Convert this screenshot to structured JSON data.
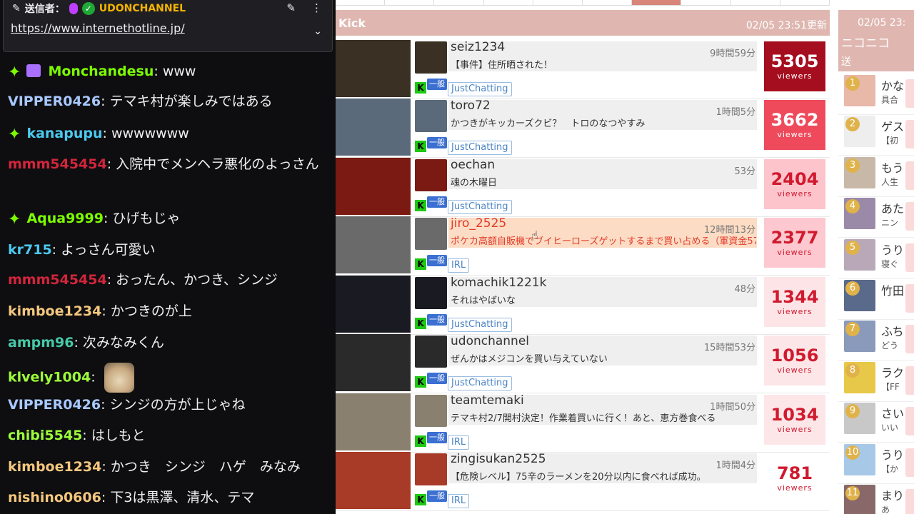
{
  "chat": {
    "pinned": {
      "pin_icon": "pin-icon",
      "sender_label": "送信者：",
      "channel": "UDONCHANNEL",
      "url": "https://www.internethotline.jp/",
      "colors": {
        "mic": "#bf3fff",
        "verified": "#1fa836",
        "channel": "#f4b400"
      }
    },
    "messages": [
      {
        "badges": [
          "sparkle-badge",
          "gift-badge"
        ],
        "user": "Monchandesu",
        "color": "#7CFC00",
        "text": "www"
      },
      {
        "badges": [],
        "user": "VIPPER0426",
        "color": "#a8c8ff",
        "text": "テマキ村が楽しみではある"
      },
      {
        "badges": [
          "sparkle-badge"
        ],
        "user": "kanapupu",
        "color": "#4cc9f0",
        "text": "wwwwwww"
      },
      {
        "badges": [],
        "user": "mmm545454",
        "color": "#d3253c",
        "text": "入院中でメンヘラ悪化のよっさん"
      },
      {
        "badges": [
          "sparkle-badge"
        ],
        "user": "Aqua9999",
        "color": "#7CFC00",
        "text": "ひげもじゃ"
      },
      {
        "badges": [],
        "user": "kr715",
        "color": "#4cc9f0",
        "text": "よっさん可愛い"
      },
      {
        "badges": [],
        "user": "mmm545454",
        "color": "#d3253c",
        "text": "おったん、かつき、シンジ"
      },
      {
        "badges": [],
        "user": "kimboe1234",
        "color": "#f5c77e",
        "text": "かつきのが上"
      },
      {
        "badges": [],
        "user": "ampm96",
        "color": "#46c9a8",
        "text": "次みなみくん"
      },
      {
        "badges": [],
        "user": "klvely1004",
        "color": "#9dfc39",
        "text": "",
        "emote": "cat-emote"
      },
      {
        "badges": [],
        "user": "VIPPER0426",
        "color": "#a8c8ff",
        "text": "シンジの方が上じゃね"
      },
      {
        "badges": [],
        "user": "chibi5545",
        "color": "#9dfc39",
        "text": "はしもと"
      },
      {
        "badges": [],
        "user": "kimboe1234",
        "color": "#f5c77e",
        "text": "かつき　シンジ　ハゲ　みなみ"
      },
      {
        "badges": [],
        "user": "nishino0606",
        "color": "#f5c77e",
        "text": "下3は黒澤、清水、テマ"
      }
    ]
  },
  "ranking": {
    "title": "Kick",
    "updated": "02/05 23:51更新",
    "viewers_label": "viewers",
    "general_badge": "一般",
    "k_logo": "K",
    "rows": [
      {
        "name": "seiz1234",
        "title": "【事件】住所晒された！",
        "duration": "9時間59分",
        "viewers": "5305",
        "category": "JustChatting",
        "box_color": "#a50e1e",
        "num_color": "#ffffff",
        "highlight": false
      },
      {
        "name": "toro72",
        "title": "かつきがキッカーズクビ？　トロのなつやすみ",
        "duration": "1時間5分",
        "viewers": "3662",
        "category": "JustChatting",
        "box_color": "#ee4a5c",
        "num_color": "#ffffff",
        "highlight": false
      },
      {
        "name": "oechan",
        "title": "魂の木曜日",
        "duration": "53分",
        "viewers": "2404",
        "category": "JustChatting",
        "box_color": "#fdc4cc",
        "num_color": "#d01a2e",
        "highlight": false
      },
      {
        "name": "jiro_2525",
        "title": "ポケカ高額自販機でブイヒーローズゲットするまで買い占める（軍資金57",
        "duration": "12時間13分",
        "viewers": "2377",
        "category": "IRL",
        "box_color": "#fdc8cf",
        "num_color": "#d01a2e",
        "highlight": true
      },
      {
        "name": "komachik1221k",
        "title": "それはやばいな",
        "duration": "48分",
        "viewers": "1344",
        "category": "JustChatting",
        "box_color": "#fde4e6",
        "num_color": "#d01a2e",
        "highlight": false
      },
      {
        "name": "udonchannel",
        "title": "ぜんかはメジコンを買い与えていない",
        "duration": "15時間53分",
        "viewers": "1056",
        "category": "JustChatting",
        "box_color": "#fde6e8",
        "num_color": "#d01a2e",
        "highlight": false
      },
      {
        "name": "teamtemaki",
        "title": "テマキ村2/7開村決定！作業着買いに行く！あと、恵方巻食べる",
        "duration": "1時間50分",
        "viewers": "1034",
        "category": "IRL",
        "box_color": "#fde6e8",
        "num_color": "#d01a2e",
        "highlight": false
      },
      {
        "name": "zingisukan2525",
        "title": "【危険レベル】75辛のラーメンを20分以内に食べれば成功。",
        "duration": "1時間4分",
        "viewers": "781",
        "category": "IRL",
        "box_color": "#ffffff",
        "num_color": "#d01a2e",
        "highlight": false
      }
    ]
  },
  "nico": {
    "updated": "02/05 23:",
    "title": "ニコニコ",
    "send": "送",
    "rows": [
      {
        "rank": "1",
        "name": "かな",
        "sub": "具合"
      },
      {
        "rank": "2",
        "name": "ゲス",
        "sub": "【初"
      },
      {
        "rank": "3",
        "name": "もう",
        "sub": "人生"
      },
      {
        "rank": "4",
        "name": "あた",
        "sub": "ニン"
      },
      {
        "rank": "5",
        "name": "うり",
        "sub": "寝ぐ"
      },
      {
        "rank": "6",
        "name": "竹田",
        "sub": ""
      },
      {
        "rank": "7",
        "name": "ふち",
        "sub": "どう"
      },
      {
        "rank": "8",
        "name": "ラク",
        "sub": "【FF"
      },
      {
        "rank": "9",
        "name": "さい",
        "sub": "いい"
      },
      {
        "rank": "10",
        "name": "うり",
        "sub": "【か"
      },
      {
        "rank": "11",
        "name": "まり",
        "sub": "あ"
      }
    ]
  }
}
